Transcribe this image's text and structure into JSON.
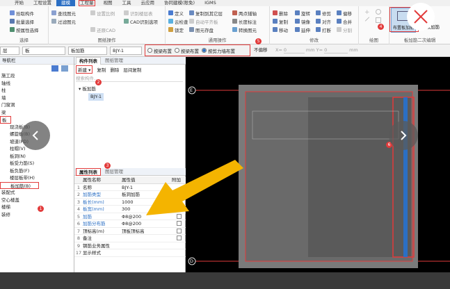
{
  "menubar": [
    "开始",
    "工程设置",
    "建模",
    "工程量",
    "视图",
    "工具",
    "云应用",
    "协同建模(限免)",
    "IGMS"
  ],
  "menubar_active_index": 2,
  "ribbon": {
    "g1": {
      "items": [
        "拾取构件",
        "批量选择",
        "按属性选择"
      ],
      "label": "选择"
    },
    "g2": {
      "items": [
        "查找图元",
        "过滤图元",
        "设置比例",
        "还原CAD",
        "识别楼层表",
        "CAD识别选项"
      ],
      "label": "图纸操作"
    },
    "g3": {
      "items": [
        "定义",
        "云检查",
        "锁定",
        "复制到其它层",
        "自动平齐板",
        "图元存盘",
        "两点辅轴",
        "长度标注",
        "转换图元"
      ],
      "label": "通用操作"
    },
    "g4": {
      "items": [
        "删除",
        "复制",
        "移动",
        "旋转",
        "镜像",
        "延伸",
        "修剪",
        "对齐",
        "打断",
        "偏移",
        "合并",
        "分割"
      ],
      "label": "修改"
    },
    "g5": {
      "label": "绘图"
    },
    "g6": {
      "items": [
        "布置板加筋",
        "查改加筋"
      ],
      "label": "板加筋二次编辑"
    }
  },
  "toolbar2": {
    "floor": "层",
    "type": "板",
    "subtype": "板加筋",
    "component": "BJY-1",
    "radios": [
      "按梁布置",
      "按梁布置",
      "按剪力墙布置"
    ],
    "radio_selected": 2,
    "offset_label": "不偏移",
    "x_label": "X=",
    "x_value": "0",
    "y_label": "mm Y=",
    "y_value": "0",
    "unit": "mm"
  },
  "leftpanel": {
    "title": "导航栏",
    "nodes": [
      "施工段",
      "轴线",
      "柱",
      "墙",
      "门窗洞",
      "梁",
      "板",
      "现浇板(B)",
      "螺旋板(B)",
      "坡道(PD)",
      "柱帽(V)",
      "板洞(N)",
      "板受力筋(S)",
      "板负筋(F)",
      "楼层板带(H)",
      "板加筋(B)",
      "装配式",
      "空心楼盖",
      "楼梯",
      "装修"
    ]
  },
  "midpanel": {
    "tabs": [
      "构件列表",
      "图纸管理"
    ],
    "toolbar": [
      "新建",
      "复制",
      "删除",
      "层间复制"
    ],
    "search_placeholder": "搜索构件...",
    "tree_parent": "板加筋",
    "tree_child": "BJY-1",
    "props_tabs": [
      "属性列表",
      "图层管理"
    ],
    "props_header": [
      "属性名称",
      "属性值",
      "附加"
    ],
    "props": [
      {
        "n": "1",
        "name": "名称",
        "value": "BJY-1",
        "blue": false,
        "chk": false
      },
      {
        "n": "2",
        "name": "加筋类型",
        "value": "板洞加筋",
        "blue": true,
        "chk": false
      },
      {
        "n": "3",
        "name": "板长(mm)",
        "value": "1000",
        "blue": true,
        "chk": false
      },
      {
        "n": "4",
        "name": "板宽(mm)",
        "value": "300",
        "blue": true,
        "chk": true
      },
      {
        "n": "5",
        "name": "加筋",
        "value": "Φ8@200",
        "blue": true,
        "chk": true
      },
      {
        "n": "6",
        "name": "加筋分布筋",
        "value": "Φ8@200",
        "blue": true,
        "chk": true
      },
      {
        "n": "7",
        "name": "顶标高(m)",
        "value": "顶板顶标高",
        "blue": false,
        "chk": true
      },
      {
        "n": "8",
        "name": "备注",
        "value": "",
        "blue": false,
        "chk": true
      },
      {
        "n": "9",
        "name": "钢筋业务属性",
        "value": "",
        "blue": false,
        "chk": false,
        "expand": true
      },
      {
        "n": "17",
        "name": "显示样式",
        "value": "",
        "blue": false,
        "chk": false,
        "expand": true
      }
    ]
  },
  "canvas": {
    "axis_top": "E",
    "axis_bottom": "D"
  },
  "badges": [
    "1",
    "2",
    "3",
    "4",
    "5",
    "6"
  ],
  "colors": {
    "accent": "#2b6fc4",
    "annotation": "#e23b3b",
    "arrow": "#f4b400"
  }
}
